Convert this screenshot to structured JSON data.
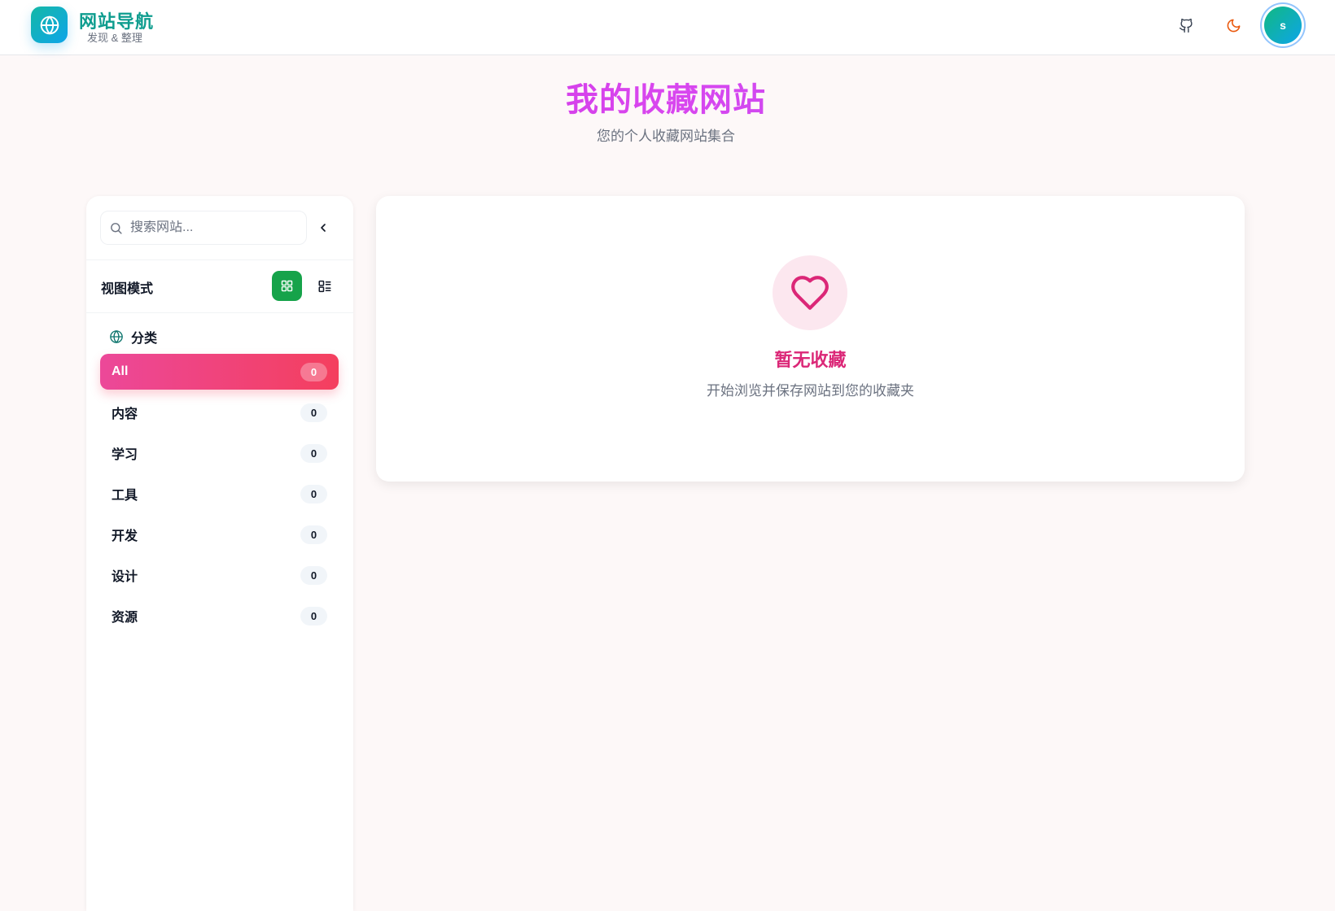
{
  "header": {
    "brand_title": "网站导航",
    "brand_subtitle": "发现 & 整理",
    "logo_icon": "globe-icon",
    "github_icon": "github-icon",
    "theme_icon": "moon-icon",
    "avatar_initial": "s"
  },
  "hero": {
    "title": "我的收藏网站",
    "subtitle": "您的个人收藏网站集合"
  },
  "sidebar": {
    "search_placeholder": "搜索网站...",
    "view_mode_label": "视图模式",
    "categories_label": "分类",
    "categories": [
      {
        "label": "All",
        "count": "0",
        "active": true
      },
      {
        "label": "内容",
        "count": "0"
      },
      {
        "label": "学习",
        "count": "0"
      },
      {
        "label": "工具",
        "count": "0"
      },
      {
        "label": "开发",
        "count": "0"
      },
      {
        "label": "设计",
        "count": "0"
      },
      {
        "label": "资源",
        "count": "0"
      }
    ]
  },
  "main": {
    "empty_title": "暂无收藏",
    "empty_description": "开始浏览并保存网站到您的收藏夹"
  },
  "colors": {
    "accent_teal": "#14b8a6",
    "accent_pink": "#ec4899",
    "hero_purple": "#c026d3",
    "grid_button_green": "#16a34a",
    "heart": "#db2777"
  }
}
